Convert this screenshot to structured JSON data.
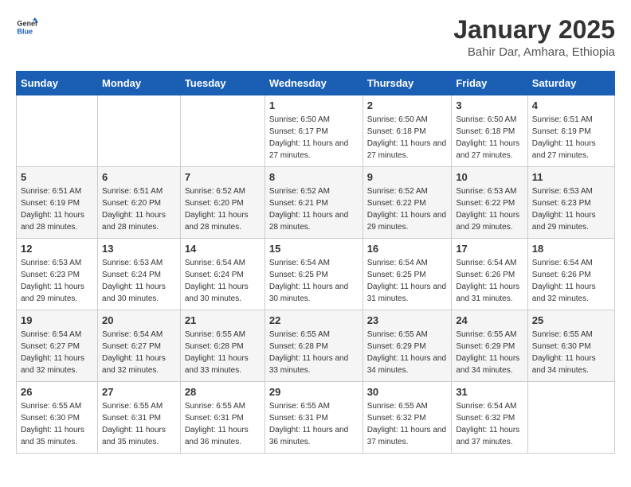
{
  "logo": {
    "text_general": "General",
    "text_blue": "Blue"
  },
  "title": "January 2025",
  "subtitle": "Bahir Dar, Amhara, Ethiopia",
  "header": {
    "colors": {
      "blue": "#1a5fb4"
    }
  },
  "days_of_week": [
    "Sunday",
    "Monday",
    "Tuesday",
    "Wednesday",
    "Thursday",
    "Friday",
    "Saturday"
  ],
  "weeks": [
    {
      "row": 1,
      "cells": [
        {
          "day": "",
          "detail": ""
        },
        {
          "day": "",
          "detail": ""
        },
        {
          "day": "",
          "detail": ""
        },
        {
          "day": "1",
          "detail": "Sunrise: 6:50 AM\nSunset: 6:17 PM\nDaylight: 11 hours and 27 minutes."
        },
        {
          "day": "2",
          "detail": "Sunrise: 6:50 AM\nSunset: 6:18 PM\nDaylight: 11 hours and 27 minutes."
        },
        {
          "day": "3",
          "detail": "Sunrise: 6:50 AM\nSunset: 6:18 PM\nDaylight: 11 hours and 27 minutes."
        },
        {
          "day": "4",
          "detail": "Sunrise: 6:51 AM\nSunset: 6:19 PM\nDaylight: 11 hours and 27 minutes."
        }
      ]
    },
    {
      "row": 2,
      "cells": [
        {
          "day": "5",
          "detail": "Sunrise: 6:51 AM\nSunset: 6:19 PM\nDaylight: 11 hours and 28 minutes."
        },
        {
          "day": "6",
          "detail": "Sunrise: 6:51 AM\nSunset: 6:20 PM\nDaylight: 11 hours and 28 minutes."
        },
        {
          "day": "7",
          "detail": "Sunrise: 6:52 AM\nSunset: 6:20 PM\nDaylight: 11 hours and 28 minutes."
        },
        {
          "day": "8",
          "detail": "Sunrise: 6:52 AM\nSunset: 6:21 PM\nDaylight: 11 hours and 28 minutes."
        },
        {
          "day": "9",
          "detail": "Sunrise: 6:52 AM\nSunset: 6:22 PM\nDaylight: 11 hours and 29 minutes."
        },
        {
          "day": "10",
          "detail": "Sunrise: 6:53 AM\nSunset: 6:22 PM\nDaylight: 11 hours and 29 minutes."
        },
        {
          "day": "11",
          "detail": "Sunrise: 6:53 AM\nSunset: 6:23 PM\nDaylight: 11 hours and 29 minutes."
        }
      ]
    },
    {
      "row": 3,
      "cells": [
        {
          "day": "12",
          "detail": "Sunrise: 6:53 AM\nSunset: 6:23 PM\nDaylight: 11 hours and 29 minutes."
        },
        {
          "day": "13",
          "detail": "Sunrise: 6:53 AM\nSunset: 6:24 PM\nDaylight: 11 hours and 30 minutes."
        },
        {
          "day": "14",
          "detail": "Sunrise: 6:54 AM\nSunset: 6:24 PM\nDaylight: 11 hours and 30 minutes."
        },
        {
          "day": "15",
          "detail": "Sunrise: 6:54 AM\nSunset: 6:25 PM\nDaylight: 11 hours and 30 minutes."
        },
        {
          "day": "16",
          "detail": "Sunrise: 6:54 AM\nSunset: 6:25 PM\nDaylight: 11 hours and 31 minutes."
        },
        {
          "day": "17",
          "detail": "Sunrise: 6:54 AM\nSunset: 6:26 PM\nDaylight: 11 hours and 31 minutes."
        },
        {
          "day": "18",
          "detail": "Sunrise: 6:54 AM\nSunset: 6:26 PM\nDaylight: 11 hours and 32 minutes."
        }
      ]
    },
    {
      "row": 4,
      "cells": [
        {
          "day": "19",
          "detail": "Sunrise: 6:54 AM\nSunset: 6:27 PM\nDaylight: 11 hours and 32 minutes."
        },
        {
          "day": "20",
          "detail": "Sunrise: 6:54 AM\nSunset: 6:27 PM\nDaylight: 11 hours and 32 minutes."
        },
        {
          "day": "21",
          "detail": "Sunrise: 6:55 AM\nSunset: 6:28 PM\nDaylight: 11 hours and 33 minutes."
        },
        {
          "day": "22",
          "detail": "Sunrise: 6:55 AM\nSunset: 6:28 PM\nDaylight: 11 hours and 33 minutes."
        },
        {
          "day": "23",
          "detail": "Sunrise: 6:55 AM\nSunset: 6:29 PM\nDaylight: 11 hours and 34 minutes."
        },
        {
          "day": "24",
          "detail": "Sunrise: 6:55 AM\nSunset: 6:29 PM\nDaylight: 11 hours and 34 minutes."
        },
        {
          "day": "25",
          "detail": "Sunrise: 6:55 AM\nSunset: 6:30 PM\nDaylight: 11 hours and 34 minutes."
        }
      ]
    },
    {
      "row": 5,
      "cells": [
        {
          "day": "26",
          "detail": "Sunrise: 6:55 AM\nSunset: 6:30 PM\nDaylight: 11 hours and 35 minutes."
        },
        {
          "day": "27",
          "detail": "Sunrise: 6:55 AM\nSunset: 6:31 PM\nDaylight: 11 hours and 35 minutes."
        },
        {
          "day": "28",
          "detail": "Sunrise: 6:55 AM\nSunset: 6:31 PM\nDaylight: 11 hours and 36 minutes."
        },
        {
          "day": "29",
          "detail": "Sunrise: 6:55 AM\nSunset: 6:31 PM\nDaylight: 11 hours and 36 minutes."
        },
        {
          "day": "30",
          "detail": "Sunrise: 6:55 AM\nSunset: 6:32 PM\nDaylight: 11 hours and 37 minutes."
        },
        {
          "day": "31",
          "detail": "Sunrise: 6:54 AM\nSunset: 6:32 PM\nDaylight: 11 hours and 37 minutes."
        },
        {
          "day": "",
          "detail": ""
        }
      ]
    }
  ]
}
